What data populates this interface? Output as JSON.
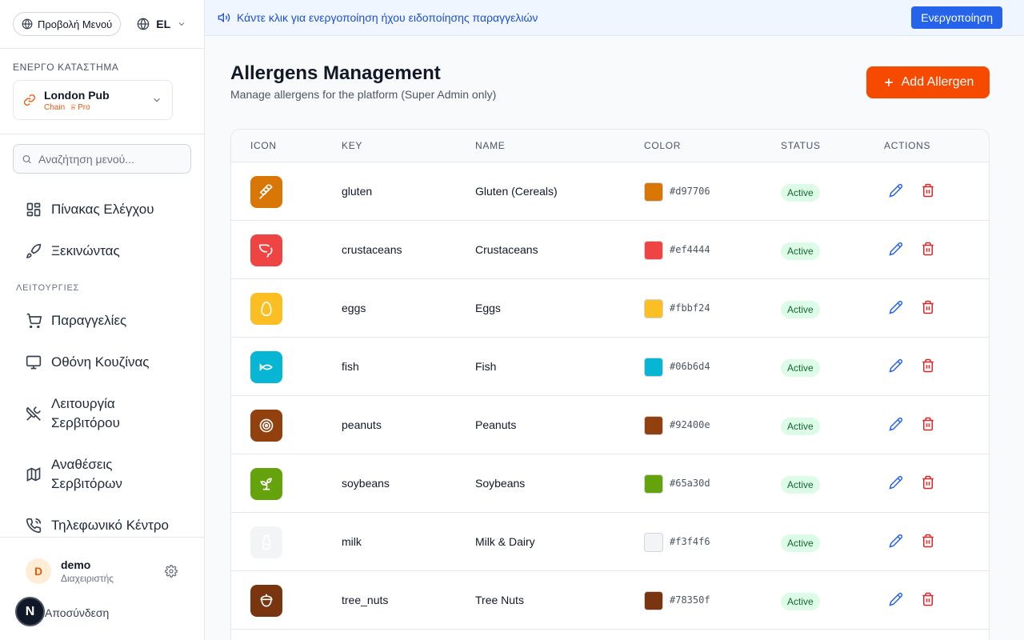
{
  "banner": {
    "text": "Κάντε κλικ για ενεργοποίηση ήχου ειδοποίησης παραγγελιών",
    "button": "Ενεργοποίηση"
  },
  "sidebar": {
    "menu_view": "Προβολή Μενού",
    "language": "EL",
    "active_store_label": "ΕΝΕΡΓΟ ΚΑΤΑΣΤΗΜΑ",
    "store": {
      "name": "London Pub",
      "type": "Chain",
      "plan": "Pro"
    },
    "search_placeholder": "Αναζήτηση μενού...",
    "items": [
      {
        "label": "Πίνακας Ελέγχου",
        "icon": "grid-icon"
      },
      {
        "label": "Ξεκινώντας",
        "icon": "rocket-icon"
      }
    ],
    "group_label": "ΛΕΙΤΟΥΡΓΙΕΣ",
    "group_items": [
      {
        "label": "Παραγγελίες",
        "icon": "cart-icon"
      },
      {
        "label": "Οθόνη Κουζίνας",
        "icon": "monitor-icon"
      },
      {
        "label_line1": "Λειτουργία",
        "label_line2": "Σερβιτόρου",
        "icon": "utensils-icon"
      },
      {
        "label_line1": "Αναθέσεις",
        "label_line2": "Σερβιτόρων",
        "icon": "map-icon"
      },
      {
        "label": "Τηλεφωνικό Κέντρο",
        "icon": "phone-icon"
      }
    ],
    "user": {
      "initial": "D",
      "name": "demo",
      "role": "Διαχειριστής"
    },
    "logout": "Αποσύνδεση",
    "badge": "N"
  },
  "main": {
    "title": "Allergens Management",
    "subtitle": "Manage allergens for the platform (Super Admin only)",
    "add_button": "Add Allergen",
    "columns": [
      "ICON",
      "KEY",
      "NAME",
      "COLOR",
      "STATUS",
      "ACTIONS"
    ],
    "rows": [
      {
        "key": "gluten",
        "name": "Gluten (Cereals)",
        "color": "#d97706",
        "status": "Active",
        "icon": "wheat-icon"
      },
      {
        "key": "crustaceans",
        "name": "Crustaceans",
        "color": "#ef4444",
        "status": "Active",
        "icon": "shrimp-icon"
      },
      {
        "key": "eggs",
        "name": "Eggs",
        "color": "#fbbf24",
        "status": "Active",
        "icon": "egg-icon"
      },
      {
        "key": "fish",
        "name": "Fish",
        "color": "#06b6d4",
        "status": "Active",
        "icon": "fish-icon"
      },
      {
        "key": "peanuts",
        "name": "Peanuts",
        "color": "#92400e",
        "status": "Active",
        "icon": "nut-icon"
      },
      {
        "key": "soybeans",
        "name": "Soybeans",
        "color": "#65a30d",
        "status": "Active",
        "icon": "sprout-icon"
      },
      {
        "key": "milk",
        "name": "Milk & Dairy",
        "color": "#f3f4f6",
        "status": "Active",
        "icon": "milk-icon"
      },
      {
        "key": "tree_nuts",
        "name": "Tree Nuts",
        "color": "#78350f",
        "status": "Active",
        "icon": "acorn-icon"
      }
    ]
  }
}
